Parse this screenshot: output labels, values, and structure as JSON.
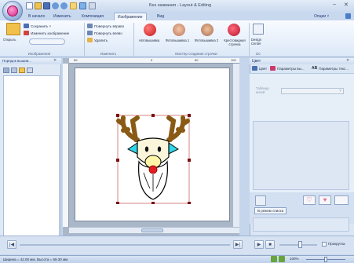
{
  "window": {
    "title": "Без названия - Layout & Editing",
    "minimize": "–",
    "close": "✕"
  },
  "tabs": [
    {
      "label": "В начало",
      "active": false
    },
    {
      "label": "Изменить",
      "active": false
    },
    {
      "label": "Композиция",
      "active": false
    },
    {
      "label": "Изображение",
      "active": true
    },
    {
      "label": "Вид",
      "active": false
    }
  ],
  "options_label": "Опции ˅",
  "ribbon": {
    "open_label": "Открыть",
    "save_label": "Сохранить ˅",
    "change_image_label": "Изменить изображение",
    "group_images": "Изображения",
    "rotate_right": "Повернуть вправо",
    "rotate_left": "Повернуть влево",
    "delete_label": "Удалить",
    "group_change": "Изменить",
    "wizard_items": [
      {
        "label": "Автовышивка",
        "color": "#d62828"
      },
      {
        "label": "Фотовышивка 1",
        "color": "#e6a08a"
      },
      {
        "label": "Фотовышивка 2",
        "color": "#d9a385"
      },
      {
        "label": "Крестовидная строчка",
        "color": "#c9263b"
      }
    ],
    "group_wizard": "Мастер создания строчки",
    "design_center_label": "Design Center",
    "group_dc": "Dc"
  },
  "left_panel": {
    "title": "Порядок вышив...",
    "close": "✕"
  },
  "right_panel": {
    "title": "Цвет",
    "tabs": [
      "Цвет",
      "Параметры вы...",
      "Параметры текс..."
    ],
    "thread_table_label": "Таблица нитей",
    "mode_button": "В режим списка",
    "close": "✕"
  },
  "ruler_marks": [
    "50",
    "0",
    "50",
    "100"
  ],
  "bottom_bar": {
    "preview_label": "Прокрутка"
  },
  "status": {
    "size_text": "Ширина = 42.00 мм, Высота = 69.30 мм",
    "zoom": "100%"
  },
  "colors": {
    "antler": "#8a5a14",
    "face": "#fbf5dc",
    "cheek": "#2ed6e8",
    "nose": "#e02020",
    "beard": "#ffffff",
    "accent": "#1f3d75"
  }
}
